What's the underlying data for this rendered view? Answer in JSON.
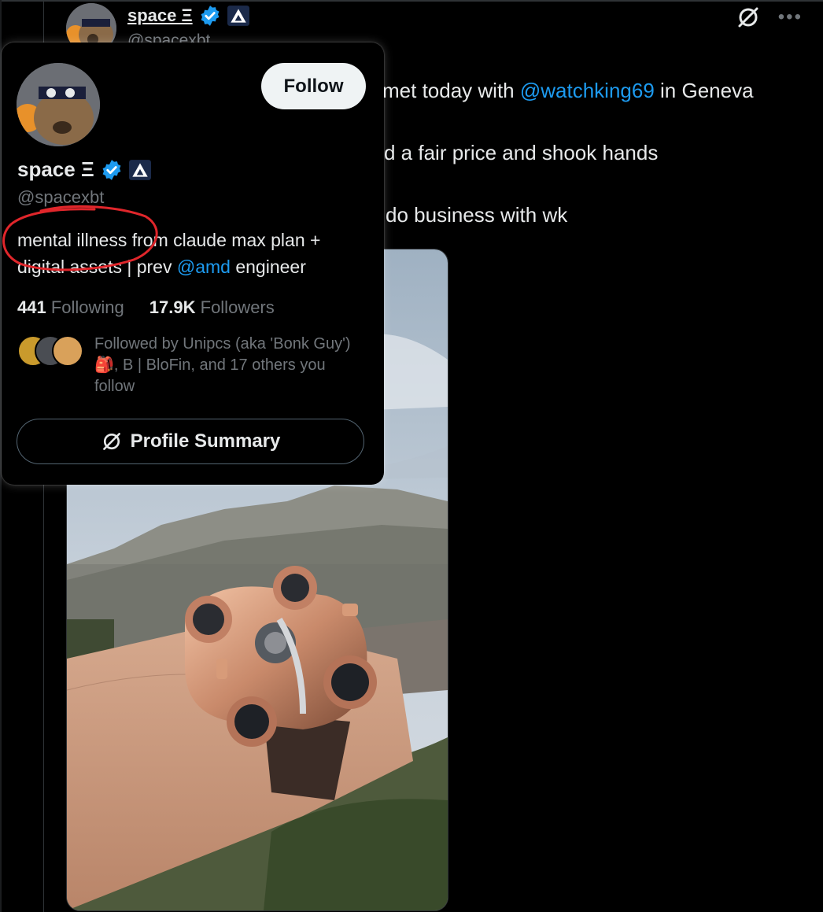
{
  "tweet": {
    "display_name": "space Ξ",
    "handle": "@spacexbt",
    "line1_before": "met today with ",
    "line1_mention": "@watchking69",
    "line1_after": " in Geneva",
    "line2": "d a fair price and shook hands",
    "line3": "do business with wk",
    "more_icon": "more-dots-icon",
    "grok_icon": "grok-icon"
  },
  "hover_card": {
    "follow_label": "Follow",
    "display_name": "space Ξ",
    "handle": "@spacexbt",
    "bio_line1": "mental illness from claude max plan +",
    "bio_line2_before": "digital assets | prev ",
    "bio_mention": "@amd",
    "bio_line2_after": " engineer",
    "following_count": "441",
    "following_label": "Following",
    "followers_count": "17.9K",
    "followers_label": "Followers",
    "followed_by": "Followed by Unipcs (aka 'Bonk Guy') 🎒, B | BloFin, and 17 others you follow",
    "summary_label": "Profile Summary"
  },
  "colors": {
    "background": "#000000",
    "text_primary": "#e7e9ea",
    "text_secondary": "#71767b",
    "link": "#1d9bf0",
    "annotation": "#e0262b"
  }
}
